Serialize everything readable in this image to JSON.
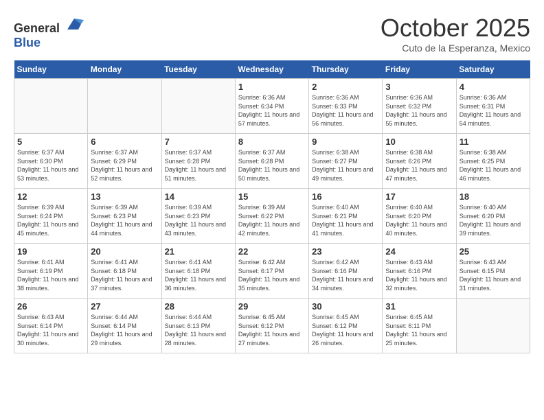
{
  "logo": {
    "general": "General",
    "blue": "Blue"
  },
  "header": {
    "title": "October 2025",
    "subtitle": "Cuto de la Esperanza, Mexico"
  },
  "weekdays": [
    "Sunday",
    "Monday",
    "Tuesday",
    "Wednesday",
    "Thursday",
    "Friday",
    "Saturday"
  ],
  "weeks": [
    [
      {
        "day": "",
        "sunrise": "",
        "sunset": "",
        "daylight": ""
      },
      {
        "day": "",
        "sunrise": "",
        "sunset": "",
        "daylight": ""
      },
      {
        "day": "",
        "sunrise": "",
        "sunset": "",
        "daylight": ""
      },
      {
        "day": "1",
        "sunrise": "Sunrise: 6:36 AM",
        "sunset": "Sunset: 6:34 PM",
        "daylight": "Daylight: 11 hours and 57 minutes."
      },
      {
        "day": "2",
        "sunrise": "Sunrise: 6:36 AM",
        "sunset": "Sunset: 6:33 PM",
        "daylight": "Daylight: 11 hours and 56 minutes."
      },
      {
        "day": "3",
        "sunrise": "Sunrise: 6:36 AM",
        "sunset": "Sunset: 6:32 PM",
        "daylight": "Daylight: 11 hours and 55 minutes."
      },
      {
        "day": "4",
        "sunrise": "Sunrise: 6:36 AM",
        "sunset": "Sunset: 6:31 PM",
        "daylight": "Daylight: 11 hours and 54 minutes."
      }
    ],
    [
      {
        "day": "5",
        "sunrise": "Sunrise: 6:37 AM",
        "sunset": "Sunset: 6:30 PM",
        "daylight": "Daylight: 11 hours and 53 minutes."
      },
      {
        "day": "6",
        "sunrise": "Sunrise: 6:37 AM",
        "sunset": "Sunset: 6:29 PM",
        "daylight": "Daylight: 11 hours and 52 minutes."
      },
      {
        "day": "7",
        "sunrise": "Sunrise: 6:37 AM",
        "sunset": "Sunset: 6:28 PM",
        "daylight": "Daylight: 11 hours and 51 minutes."
      },
      {
        "day": "8",
        "sunrise": "Sunrise: 6:37 AM",
        "sunset": "Sunset: 6:28 PM",
        "daylight": "Daylight: 11 hours and 50 minutes."
      },
      {
        "day": "9",
        "sunrise": "Sunrise: 6:38 AM",
        "sunset": "Sunset: 6:27 PM",
        "daylight": "Daylight: 11 hours and 49 minutes."
      },
      {
        "day": "10",
        "sunrise": "Sunrise: 6:38 AM",
        "sunset": "Sunset: 6:26 PM",
        "daylight": "Daylight: 11 hours and 47 minutes."
      },
      {
        "day": "11",
        "sunrise": "Sunrise: 6:38 AM",
        "sunset": "Sunset: 6:25 PM",
        "daylight": "Daylight: 11 hours and 46 minutes."
      }
    ],
    [
      {
        "day": "12",
        "sunrise": "Sunrise: 6:39 AM",
        "sunset": "Sunset: 6:24 PM",
        "daylight": "Daylight: 11 hours and 45 minutes."
      },
      {
        "day": "13",
        "sunrise": "Sunrise: 6:39 AM",
        "sunset": "Sunset: 6:23 PM",
        "daylight": "Daylight: 11 hours and 44 minutes."
      },
      {
        "day": "14",
        "sunrise": "Sunrise: 6:39 AM",
        "sunset": "Sunset: 6:23 PM",
        "daylight": "Daylight: 11 hours and 43 minutes."
      },
      {
        "day": "15",
        "sunrise": "Sunrise: 6:39 AM",
        "sunset": "Sunset: 6:22 PM",
        "daylight": "Daylight: 11 hours and 42 minutes."
      },
      {
        "day": "16",
        "sunrise": "Sunrise: 6:40 AM",
        "sunset": "Sunset: 6:21 PM",
        "daylight": "Daylight: 11 hours and 41 minutes."
      },
      {
        "day": "17",
        "sunrise": "Sunrise: 6:40 AM",
        "sunset": "Sunset: 6:20 PM",
        "daylight": "Daylight: 11 hours and 40 minutes."
      },
      {
        "day": "18",
        "sunrise": "Sunrise: 6:40 AM",
        "sunset": "Sunset: 6:20 PM",
        "daylight": "Daylight: 11 hours and 39 minutes."
      }
    ],
    [
      {
        "day": "19",
        "sunrise": "Sunrise: 6:41 AM",
        "sunset": "Sunset: 6:19 PM",
        "daylight": "Daylight: 11 hours and 38 minutes."
      },
      {
        "day": "20",
        "sunrise": "Sunrise: 6:41 AM",
        "sunset": "Sunset: 6:18 PM",
        "daylight": "Daylight: 11 hours and 37 minutes."
      },
      {
        "day": "21",
        "sunrise": "Sunrise: 6:41 AM",
        "sunset": "Sunset: 6:18 PM",
        "daylight": "Daylight: 11 hours and 36 minutes."
      },
      {
        "day": "22",
        "sunrise": "Sunrise: 6:42 AM",
        "sunset": "Sunset: 6:17 PM",
        "daylight": "Daylight: 11 hours and 35 minutes."
      },
      {
        "day": "23",
        "sunrise": "Sunrise: 6:42 AM",
        "sunset": "Sunset: 6:16 PM",
        "daylight": "Daylight: 11 hours and 34 minutes."
      },
      {
        "day": "24",
        "sunrise": "Sunrise: 6:43 AM",
        "sunset": "Sunset: 6:16 PM",
        "daylight": "Daylight: 11 hours and 32 minutes."
      },
      {
        "day": "25",
        "sunrise": "Sunrise: 6:43 AM",
        "sunset": "Sunset: 6:15 PM",
        "daylight": "Daylight: 11 hours and 31 minutes."
      }
    ],
    [
      {
        "day": "26",
        "sunrise": "Sunrise: 6:43 AM",
        "sunset": "Sunset: 6:14 PM",
        "daylight": "Daylight: 11 hours and 30 minutes."
      },
      {
        "day": "27",
        "sunrise": "Sunrise: 6:44 AM",
        "sunset": "Sunset: 6:14 PM",
        "daylight": "Daylight: 11 hours and 29 minutes."
      },
      {
        "day": "28",
        "sunrise": "Sunrise: 6:44 AM",
        "sunset": "Sunset: 6:13 PM",
        "daylight": "Daylight: 11 hours and 28 minutes."
      },
      {
        "day": "29",
        "sunrise": "Sunrise: 6:45 AM",
        "sunset": "Sunset: 6:12 PM",
        "daylight": "Daylight: 11 hours and 27 minutes."
      },
      {
        "day": "30",
        "sunrise": "Sunrise: 6:45 AM",
        "sunset": "Sunset: 6:12 PM",
        "daylight": "Daylight: 11 hours and 26 minutes."
      },
      {
        "day": "31",
        "sunrise": "Sunrise: 6:45 AM",
        "sunset": "Sunset: 6:11 PM",
        "daylight": "Daylight: 11 hours and 25 minutes."
      },
      {
        "day": "",
        "sunrise": "",
        "sunset": "",
        "daylight": ""
      }
    ]
  ]
}
